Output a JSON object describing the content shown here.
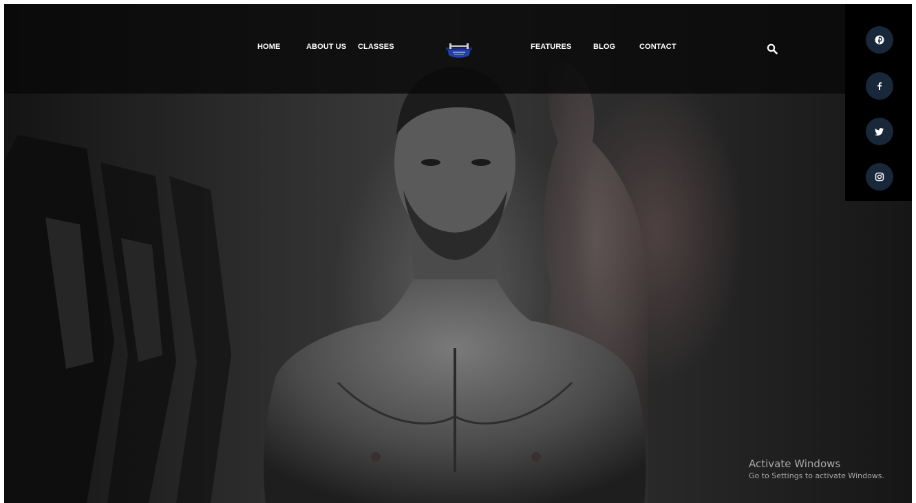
{
  "nav": {
    "items": [
      {
        "label": "HOME"
      },
      {
        "label": "ABOUT US"
      },
      {
        "label": "CLASSES"
      },
      {
        "label": "FEATURES"
      },
      {
        "label": "BLOG"
      },
      {
        "label": "CONTACT"
      }
    ],
    "logo_icon": "dumbbell-logo-icon",
    "search_icon": "search-icon"
  },
  "social": {
    "items": [
      {
        "icon": "pinterest-icon"
      },
      {
        "icon": "facebook-icon"
      },
      {
        "icon": "twitter-icon"
      },
      {
        "icon": "instagram-icon"
      }
    ],
    "button_color": "#18273a",
    "panel_color": "#000000"
  },
  "watermark": {
    "title": "Activate Windows",
    "subtitle": "Go to Settings to activate Windows."
  },
  "colors": {
    "nav_text": "#ffffff",
    "logo_blue": "#2340a8"
  }
}
